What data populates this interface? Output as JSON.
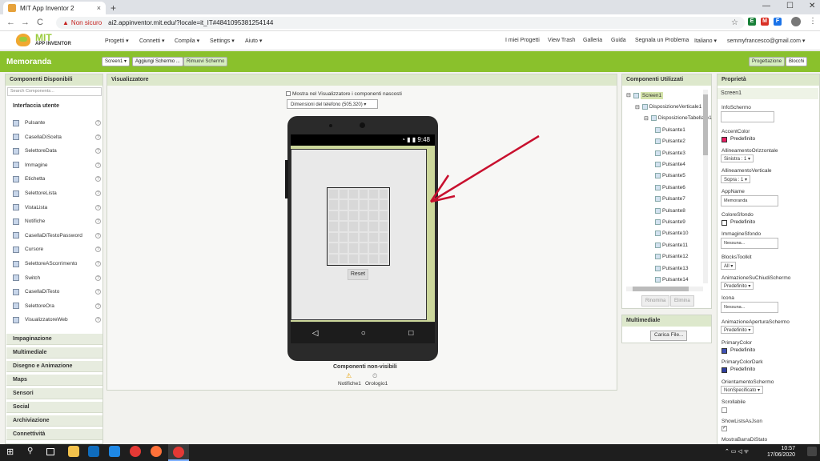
{
  "browser": {
    "tab_title": "MIT App Inventor 2",
    "tab_close": "×",
    "new_tab": "+",
    "security_warning": "Non sicuro",
    "url": "ai2.appinventor.mit.edu/?locale=it_IT#4841095381254144",
    "nav": {
      "back": "←",
      "forward": "→",
      "reload": "C"
    },
    "window_controls": {
      "minimize": "—",
      "maximize": "☐",
      "close": "✕"
    },
    "extensions": [
      {
        "label": "E",
        "color": "#188038"
      },
      {
        "label": "M",
        "color": "#d93025"
      },
      {
        "label": "F",
        "color": "#1a73e8"
      }
    ]
  },
  "app": {
    "logo_mit": "MIT",
    "logo_sub": "APP INVENTOR",
    "menu_left": [
      "Progetti ▾",
      "Connetti ▾",
      "Compila ▾",
      "Settings ▾",
      "Aiuto ▾"
    ],
    "menu_right": [
      "I miei Progetti",
      "View Trash",
      "Galleria",
      "Guida",
      "Segnala un Problema",
      "Italiano ▾",
      "semmyfrancesco@gmail.com ▾"
    ]
  },
  "toolbar": {
    "project_name": "Memoranda",
    "screen_select": "Screen1 ▾",
    "add_screen": "Aggiungi Schermo ...",
    "remove_screen": "Rimuovi Schermo",
    "designer": "Progettazione",
    "blocks": "Blocchi"
  },
  "palette": {
    "title": "Componenti Disponibili",
    "search_placeholder": "Search Components...",
    "open_category": "Interfaccia utente",
    "items": [
      "Pulsante",
      "CasellaDiScelta",
      "SelettoreData",
      "Immagine",
      "Etichetta",
      "SelettoreLista",
      "VistaLista",
      "Notifiche",
      "CasellaDiTestoPassword",
      "Cursore",
      "SelettoreAScorrimento",
      "Switch",
      "CasellaDiTesto",
      "SelettoreOra",
      "VisualizzatoreWeb"
    ],
    "help": "?",
    "categories": [
      "Impaginazione",
      "Multimediale",
      "Disegno e Animazione",
      "Maps",
      "Sensori",
      "Social",
      "Archiviazione",
      "Connettività"
    ]
  },
  "viewer": {
    "title": "Visualizzatore",
    "hidden_checkbox_label": "Mostra nel Visualizzatore i componenti nascosti",
    "size_select": "Dimensioni del telefono (505,320) ▾",
    "status_time": "9:48",
    "reset_button": "Reset",
    "nav_back": "◁",
    "nav_home": "○",
    "nav_recent": "□",
    "nonvisible_title": "Componenti non-visibili",
    "nonvisible": [
      "Notifiche1",
      "Orologio1"
    ]
  },
  "tree": {
    "title": "Componenti Utilizzati",
    "items": [
      {
        "label": "Screen1",
        "level": 0,
        "toggle": "⊟"
      },
      {
        "label": "DisposizioneVerticale1",
        "level": 1,
        "toggle": "⊟"
      },
      {
        "label": "DisposizioneTabellare1",
        "level": 2,
        "toggle": "⊟"
      },
      {
        "label": "Pulsante1",
        "level": 3
      },
      {
        "label": "Pulsante2",
        "level": 3
      },
      {
        "label": "Pulsante3",
        "level": 3
      },
      {
        "label": "Pulsante4",
        "level": 3
      },
      {
        "label": "Pulsante5",
        "level": 3
      },
      {
        "label": "Pulsante6",
        "level": 3
      },
      {
        "label": "Pulsante7",
        "level": 3
      },
      {
        "label": "Pulsante8",
        "level": 3
      },
      {
        "label": "Pulsante9",
        "level": 3
      },
      {
        "label": "Pulsante10",
        "level": 3
      },
      {
        "label": "Pulsante11",
        "level": 3
      },
      {
        "label": "Pulsante12",
        "level": 3
      },
      {
        "label": "Pulsante13",
        "level": 3
      },
      {
        "label": "Pulsante14",
        "level": 3
      }
    ],
    "rename": "Rinomina",
    "delete": "Elimina",
    "media_title": "Multimediale",
    "upload": "Carica File..."
  },
  "properties": {
    "title": "Proprietà",
    "component": "Screen1",
    "info_label": "InfoSchermo",
    "accent_label": "AccentColor",
    "accent_value": "Predefinito",
    "accent_color": "#e91e63",
    "halign_label": "AllineamentoOrizzontale",
    "halign_value": "Sinistra : 1 ▾",
    "valign_label": "AllineamentoVerticale",
    "valign_value": "Sopra : 1 ▾",
    "appname_label": "AppName",
    "appname_value": "Memoranda",
    "bg_label": "ColoreSfondo",
    "bg_value": "Predefinito",
    "bg_color": "#ffffff",
    "bgimage_label": "ImmagineSfondo",
    "bgimage_value": "Nessuna...",
    "blocks_label": "BlocksToolkit",
    "blocks_value": "All ▾",
    "close_anim_label": "AnimazioneSuChiudiSchermo",
    "close_anim_value": "Predefinito ▾",
    "icon_label": "Icona",
    "icon_value": "Nessuna...",
    "open_anim_label": "AnimazioneAperturaSchermo",
    "open_anim_value": "Predefinito ▾",
    "primary_label": "PrimaryColor",
    "primary_value": "Predefinito",
    "primary_color": "#3f51b5",
    "primary_dark_label": "PrimaryColorDark",
    "primary_dark_value": "Predefinito",
    "primary_dark_color": "#303f9f",
    "orient_label": "OrientamentoSchermo",
    "orient_value": "NonSpecificato ▾",
    "scroll_label": "Scrollabile",
    "json_label": "ShowListsAsJson",
    "json_check": "✓",
    "statusbar_label": "MostraBarraDiStato"
  },
  "taskbar": {
    "time": "10:57",
    "date": "17/06/2020",
    "start": "⊞",
    "search": "⚲"
  }
}
